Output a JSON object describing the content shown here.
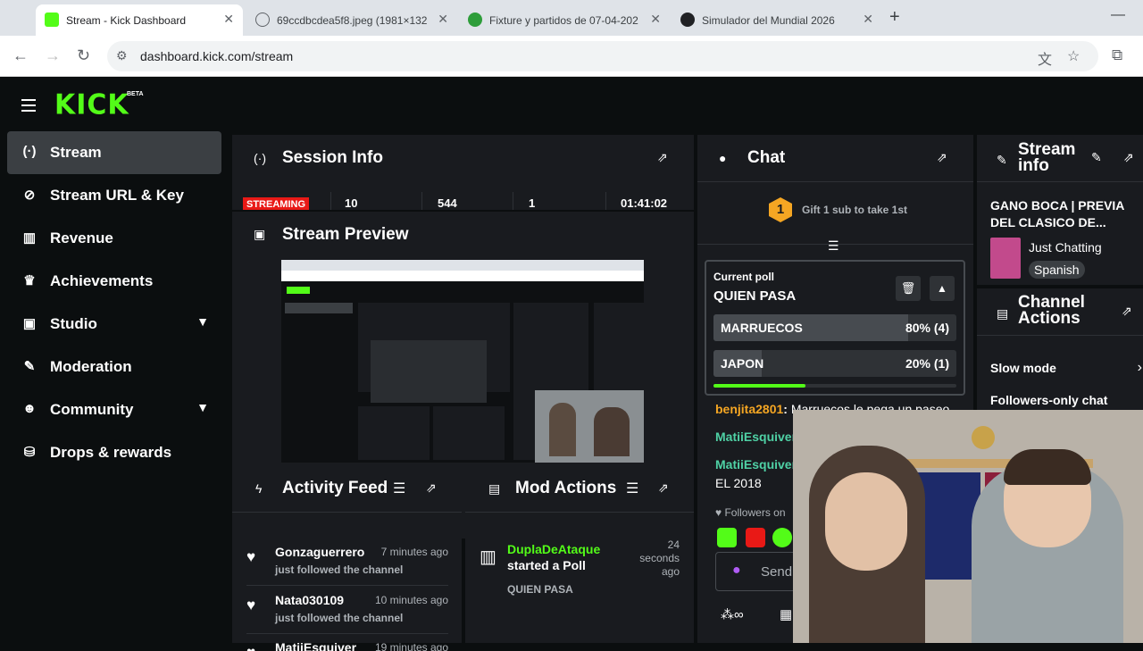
{
  "browser": {
    "tabs": [
      {
        "title": "Stream - Kick Dashboard",
        "active": true
      },
      {
        "title": "69ccdbcdea5f8.jpeg (1981×132",
        "active": false
      },
      {
        "title": "Fixture y partidos de 07-04-202",
        "active": false
      },
      {
        "title": "Simulador del Mundial 2026",
        "active": false
      }
    ],
    "url": "dashboard.kick.com/stream"
  },
  "app": {
    "logo": "KICK",
    "beta": "BETA",
    "accent": "#53fc18"
  },
  "sidebar": {
    "items": [
      {
        "label": "Stream",
        "icon": "broadcast-icon"
      },
      {
        "label": "Stream URL & Key",
        "icon": "link-icon"
      },
      {
        "label": "Revenue",
        "icon": "chart-icon"
      },
      {
        "label": "Achievements",
        "icon": "trophy-icon"
      },
      {
        "label": "Studio",
        "icon": "studio-icon"
      },
      {
        "label": "Moderation",
        "icon": "wrench-icon"
      },
      {
        "label": "Community",
        "icon": "people-icon"
      },
      {
        "label": "Drops & rewards",
        "icon": "gift-icon"
      }
    ]
  },
  "session": {
    "title": "Session Info",
    "status": "STREAMING",
    "stats": [
      "10",
      "544",
      "1",
      "01:41:02"
    ]
  },
  "preview": {
    "title": "Stream Preview"
  },
  "activity": {
    "title": "Activity Feed",
    "items": [
      {
        "name": "Gonzaguerrero",
        "time": "7 minutes ago",
        "text": "just followed the channel"
      },
      {
        "name": "Nata030109",
        "time": "10 minutes ago",
        "text": "just followed the channel"
      },
      {
        "name": "MatiiEsquiver",
        "time": "19 minutes ago",
        "text": ""
      }
    ]
  },
  "mod": {
    "title": "Mod Actions",
    "user": "DuplaDeAtaque",
    "action": "started a Poll",
    "time": "24 seconds ago",
    "detail": "QUIEN PASA"
  },
  "chat": {
    "title": "Chat",
    "gift_rank": "1",
    "gift_text": "Gift 1 sub to take 1st",
    "poll": {
      "heading": "Current poll",
      "question": "QUIEN PASA",
      "options": [
        {
          "label": "MARRUECOS",
          "pct": 80,
          "pct_text": "80% (4)"
        },
        {
          "label": "JAPON",
          "pct": 20,
          "pct_text": "20% (1)"
        }
      ],
      "timer_progress": 0.38
    },
    "messages": [
      {
        "user": "benjita2801",
        "text": "Marruecos le pega un paseo",
        "color": "#f5a623"
      },
      {
        "user": "MatiiEsquiver",
        "text": "",
        "color": "#4fd1a5"
      },
      {
        "user": "MatiiEsquiver",
        "text": "",
        "color": "#4fd1a5"
      }
    ],
    "extra_line": "EL 2018",
    "followers_note": "Followers on",
    "send_placeholder": "Send"
  },
  "stream_info": {
    "title": "Stream info",
    "stream_title": "GANO BOCA | PREVIA DEL CLASICO DE...",
    "category": "Just Chatting",
    "language": "Spanish"
  },
  "channel_actions": {
    "title": "Channel Actions",
    "items": [
      "Slow mode",
      "Followers-only chat"
    ]
  }
}
